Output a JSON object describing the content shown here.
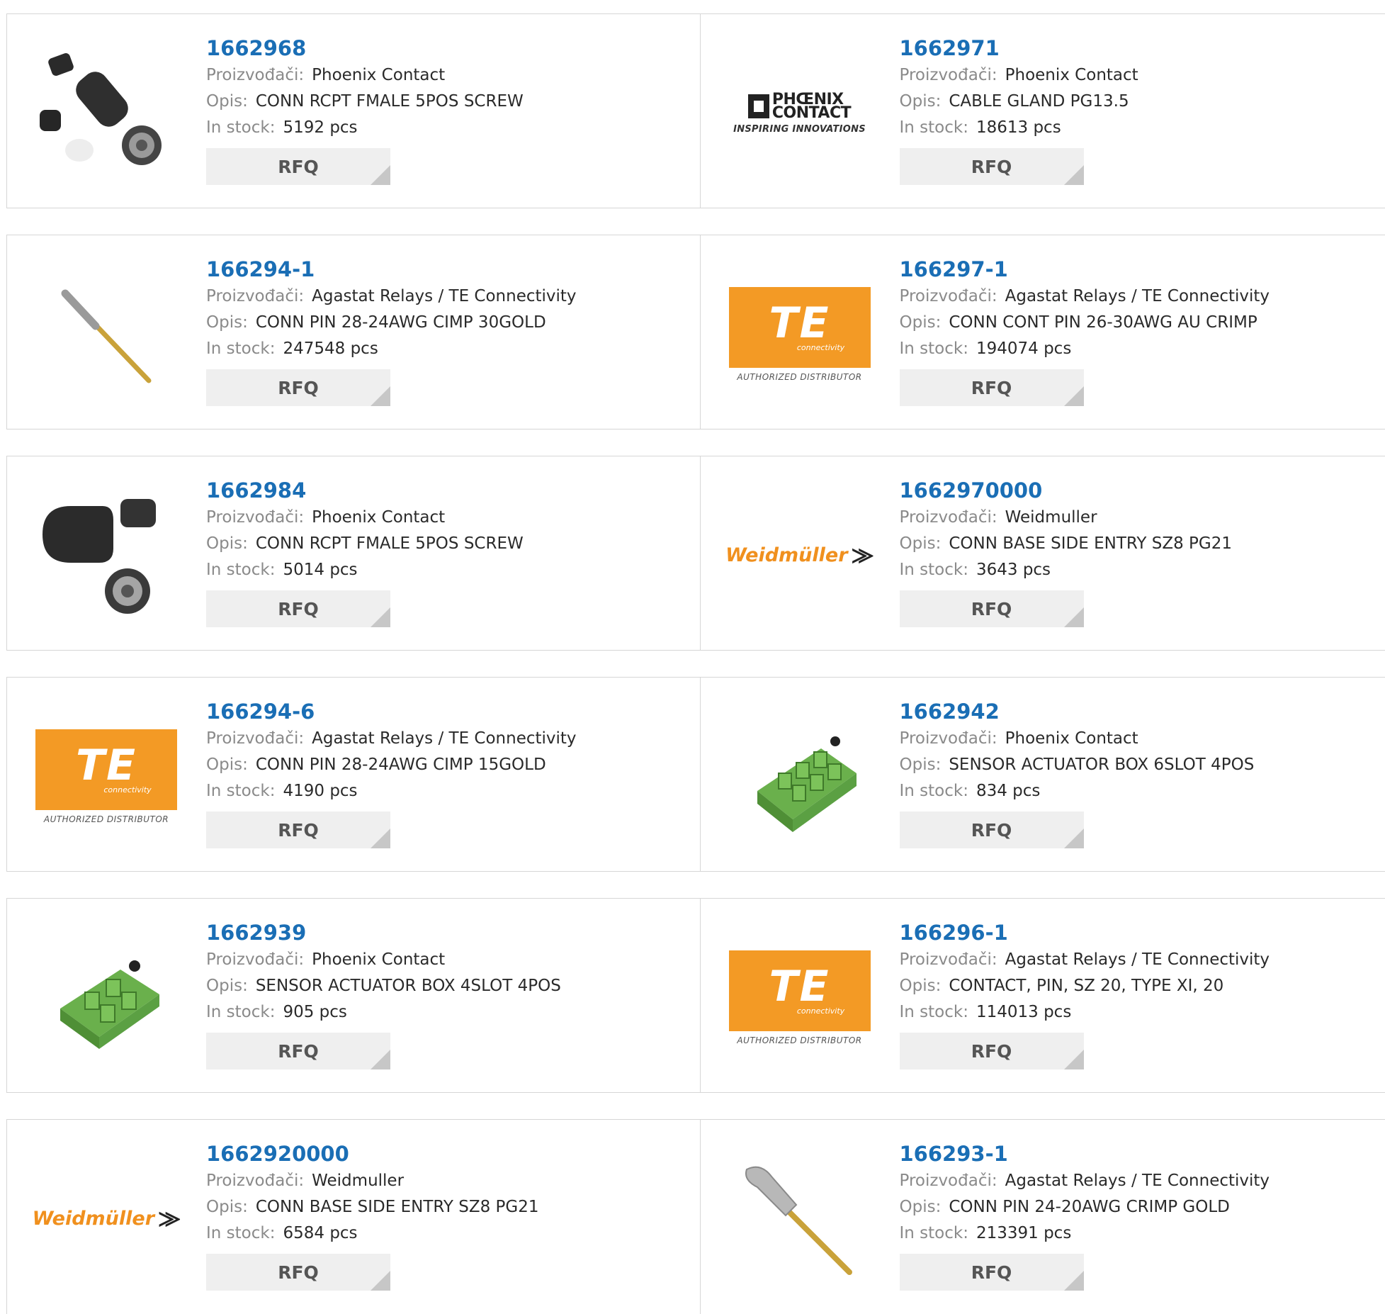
{
  "labels": {
    "manufacturer": "Proizvođači:",
    "description": "Opis:",
    "stock": "In stock:",
    "rfq": "RFQ"
  },
  "brand_text": {
    "te_logo": "TE",
    "te_sub": "connectivity",
    "te_authorized": "AUTHORIZED DISTRIBUTOR",
    "weidmuller": "Weidmüller",
    "phoenix_line1": "PHŒNIX",
    "phoenix_line2": "CONTACT",
    "phoenix_tagline": "INSPIRING INNOVATIONS"
  },
  "products": [
    {
      "part": "1662968",
      "manufacturer": "Phoenix Contact",
      "description": "CONN RCPT FMALE 5POS SCREW",
      "stock": "5192 pcs",
      "image": "connector-kit-black"
    },
    {
      "part": "1662971",
      "manufacturer": "Phoenix Contact",
      "description": "CABLE GLAND PG13.5",
      "stock": "18613 pcs",
      "image": "phoenix-contact-logo"
    },
    {
      "part": "166294-1",
      "manufacturer": "Agastat Relays / TE Connectivity",
      "description": "CONN PIN 28-24AWG CIMP 30GOLD",
      "stock": "247548 pcs",
      "image": "crimp-pin"
    },
    {
      "part": "166297-1",
      "manufacturer": "Agastat Relays / TE Connectivity",
      "description": "CONN CONT PIN 26-30AWG AU CRIMP",
      "stock": "194074 pcs",
      "image": "te-logo"
    },
    {
      "part": "1662984",
      "manufacturer": "Phoenix Contact",
      "description": "CONN RCPT FMALE 5POS SCREW",
      "stock": "5014 pcs",
      "image": "connector-angled-black"
    },
    {
      "part": "1662970000",
      "manufacturer": "Weidmuller",
      "description": "CONN BASE SIDE ENTRY SZ8 PG21",
      "stock": "3643 pcs",
      "image": "weidmuller-logo"
    },
    {
      "part": "166294-6",
      "manufacturer": "Agastat Relays / TE Connectivity",
      "description": "CONN PIN 28-24AWG CIMP 15GOLD",
      "stock": "4190 pcs",
      "image": "te-logo"
    },
    {
      "part": "1662942",
      "manufacturer": "Phoenix Contact",
      "description": "SENSOR ACTUATOR BOX 6SLOT 4POS",
      "stock": "834 pcs",
      "image": "green-box-6"
    },
    {
      "part": "1662939",
      "manufacturer": "Phoenix Contact",
      "description": "SENSOR ACTUATOR BOX 4SLOT 4POS",
      "stock": "905 pcs",
      "image": "green-box-4"
    },
    {
      "part": "166296-1",
      "manufacturer": "Agastat Relays / TE Connectivity",
      "description": "CONTACT, PIN, SZ 20, TYPE XI, 20",
      "stock": "114013 pcs",
      "image": "te-logo"
    },
    {
      "part": "1662920000",
      "manufacturer": "Weidmuller",
      "description": "CONN BASE SIDE ENTRY SZ8 PG21",
      "stock": "6584 pcs",
      "image": "weidmuller-logo"
    },
    {
      "part": "166293-1",
      "manufacturer": "Agastat Relays / TE Connectivity",
      "description": "CONN PIN 24-20AWG CRIMP GOLD",
      "stock": "213391 pcs",
      "image": "crimp-pin-large"
    }
  ]
}
